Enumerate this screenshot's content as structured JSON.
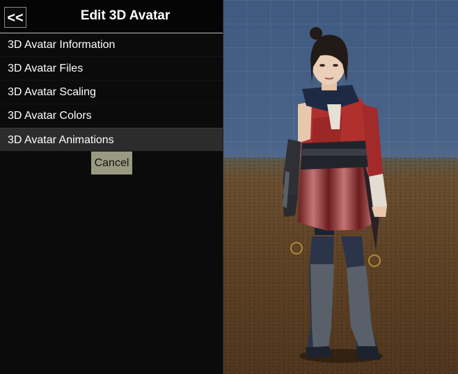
{
  "header": {
    "back_label": "<<",
    "title": "Edit 3D Avatar"
  },
  "menu": {
    "items": [
      {
        "label": "3D Avatar Information"
      },
      {
        "label": "3D Avatar Files"
      },
      {
        "label": "3D Avatar Scaling"
      },
      {
        "label": "3D Avatar Colors"
      },
      {
        "label": "3D Avatar Animations"
      }
    ],
    "cancel_label": "Cancel"
  },
  "colors": {
    "panel_bg": "#0b0b0b",
    "active_item_bg": "#2c2c2c",
    "cancel_bg": "#9a9a82",
    "sky": "#4a6488",
    "ground": "#5e4226",
    "outfit_red": "#a32a2a"
  }
}
